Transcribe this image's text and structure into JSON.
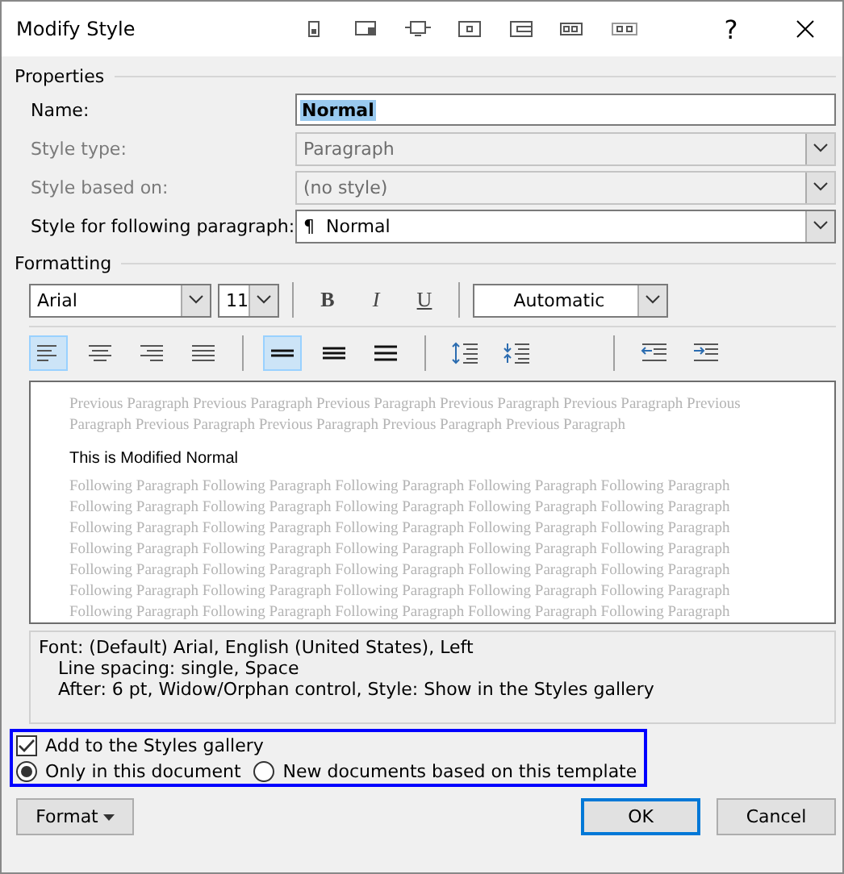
{
  "window": {
    "title": "Modify Style",
    "help": "?"
  },
  "toolbar_icons": [
    {
      "kind": "frame"
    },
    {
      "kind": "window"
    },
    {
      "kind": "device"
    },
    {
      "kind": "screen"
    },
    {
      "kind": "panel"
    },
    {
      "kind": "dual"
    },
    {
      "kind": "triple"
    }
  ],
  "properties": {
    "heading": "Properties",
    "fields": [
      {
        "label": "Name:",
        "value": "Normal",
        "kind": "text",
        "disabled": false
      },
      {
        "label": "Style type:",
        "value": "Paragraph",
        "kind": "combo",
        "disabled": true
      },
      {
        "label": "Style based on:",
        "value": "(no style)",
        "kind": "combo",
        "disabled": true
      },
      {
        "label": "Style for following paragraph:",
        "value": "¶  Normal",
        "kind": "combo",
        "disabled": false
      }
    ]
  },
  "formatting": {
    "heading": "Formatting",
    "font": "Arial",
    "size": "11",
    "bold": "B",
    "italic": "I",
    "underline": "U",
    "font_color_value": "Automatic",
    "alignment": [
      {
        "kind": "left",
        "selected": true
      },
      {
        "kind": "center",
        "selected": false
      },
      {
        "kind": "right",
        "selected": false
      },
      {
        "kind": "justify",
        "selected": false
      }
    ],
    "line_spacing": [
      {
        "kind": "single",
        "selected": true
      },
      {
        "kind": "onehalf",
        "selected": false
      },
      {
        "kind": "double",
        "selected": false
      }
    ],
    "paragraph_spacing": [
      {
        "kind": "increase"
      },
      {
        "kind": "decrease"
      }
    ],
    "indent": [
      {
        "kind": "decrease"
      },
      {
        "kind": "increase"
      }
    ]
  },
  "preview": {
    "previous": "Previous Paragraph Previous Paragraph Previous Paragraph Previous Paragraph Previous Paragraph Previous Paragraph Previous Paragraph Previous Paragraph Previous Paragraph Previous Paragraph",
    "sample": "This is Modified Normal",
    "following": [
      "Following Paragraph Following Paragraph Following Paragraph Following Paragraph Following Paragraph",
      "Following Paragraph Following Paragraph Following Paragraph Following Paragraph Following Paragraph",
      "Following Paragraph Following Paragraph Following Paragraph Following Paragraph Following Paragraph",
      "Following Paragraph Following Paragraph Following Paragraph Following Paragraph Following Paragraph",
      "Following Paragraph Following Paragraph Following Paragraph Following Paragraph Following Paragraph",
      "Following Paragraph Following Paragraph Following Paragraph Following Paragraph Following Paragraph",
      "Following Paragraph Following Paragraph Following Paragraph Following Paragraph Following Paragraph"
    ]
  },
  "description": [
    "Font: (Default) Arial, English (United States), Left",
    "Line spacing:  single, Space",
    "After:  6 pt, Widow/Orphan control, Style: Show in the Styles gallery"
  ],
  "gallery": {
    "label": "Add to the Styles gallery",
    "checked": true
  },
  "scope": [
    {
      "label": "Only in this document",
      "selected": true
    },
    {
      "label": "New documents based on this template",
      "selected": false
    }
  ],
  "buttons": {
    "format": "Format",
    "ok": "OK",
    "cancel": "Cancel"
  }
}
